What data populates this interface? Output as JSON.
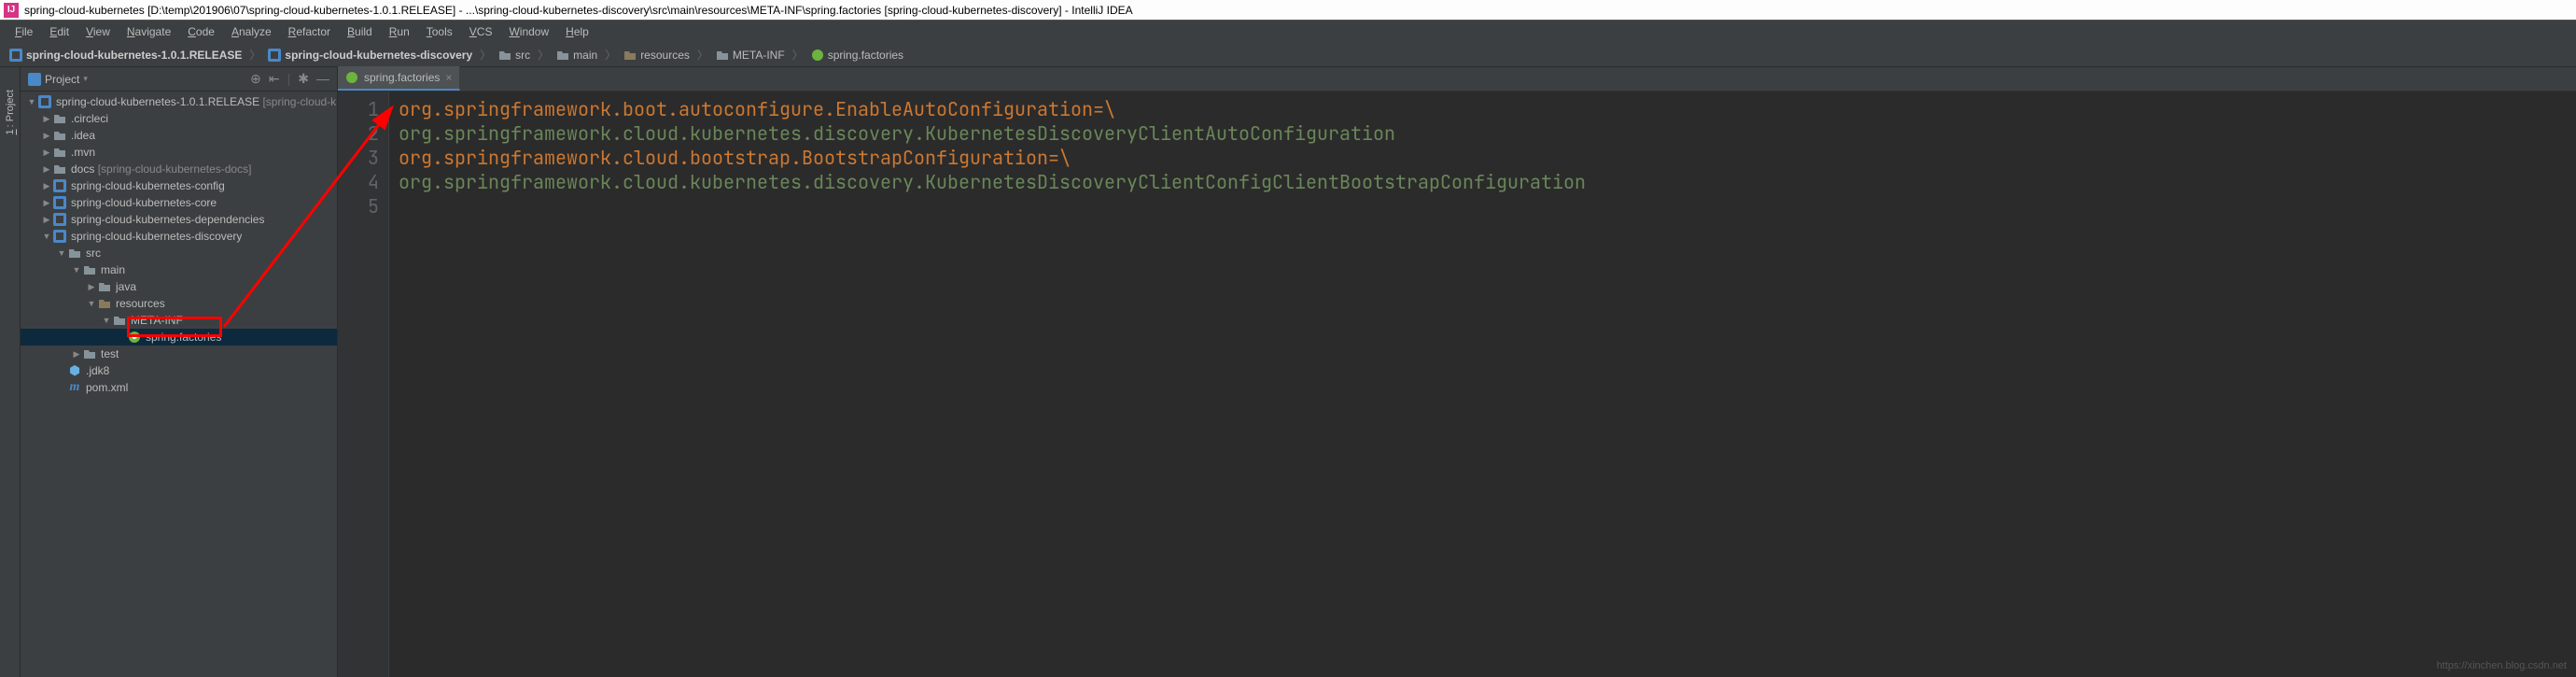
{
  "titlebar": {
    "text": "spring-cloud-kubernetes [D:\\temp\\201906\\07\\spring-cloud-kubernetes-1.0.1.RELEASE] - ...\\spring-cloud-kubernetes-discovery\\src\\main\\resources\\META-INF\\spring.factories [spring-cloud-kubernetes-discovery] - IntelliJ IDEA"
  },
  "menubar": {
    "items": [
      "File",
      "Edit",
      "View",
      "Navigate",
      "Code",
      "Analyze",
      "Refactor",
      "Build",
      "Run",
      "Tools",
      "VCS",
      "Window",
      "Help"
    ]
  },
  "breadcrumb": {
    "items": [
      {
        "label": "spring-cloud-kubernetes-1.0.1.RELEASE",
        "icon": "module",
        "bold": true
      },
      {
        "label": "spring-cloud-kubernetes-discovery",
        "icon": "module",
        "bold": true
      },
      {
        "label": "src",
        "icon": "folder"
      },
      {
        "label": "main",
        "icon": "folder"
      },
      {
        "label": "resources",
        "icon": "resources"
      },
      {
        "label": "META-INF",
        "icon": "folder"
      },
      {
        "label": "spring.factories",
        "icon": "spring"
      }
    ]
  },
  "project_panel": {
    "title": "Project",
    "gutter_label": "1: Project"
  },
  "tree": [
    {
      "depth": 0,
      "arrow": "down",
      "icon": "module",
      "label": "spring-cloud-kubernetes-1.0.1.RELEASE",
      "suffix": " [spring-cloud-k"
    },
    {
      "depth": 1,
      "arrow": "right",
      "icon": "folder",
      "label": ".circleci"
    },
    {
      "depth": 1,
      "arrow": "right",
      "icon": "folder",
      "label": ".idea"
    },
    {
      "depth": 1,
      "arrow": "right",
      "icon": "folder",
      "label": ".mvn"
    },
    {
      "depth": 1,
      "arrow": "right",
      "icon": "folder",
      "label": "docs",
      "suffix": " [spring-cloud-kubernetes-docs]"
    },
    {
      "depth": 1,
      "arrow": "right",
      "icon": "module",
      "label": "spring-cloud-kubernetes-config"
    },
    {
      "depth": 1,
      "arrow": "right",
      "icon": "module",
      "label": "spring-cloud-kubernetes-core"
    },
    {
      "depth": 1,
      "arrow": "right",
      "icon": "module",
      "label": "spring-cloud-kubernetes-dependencies"
    },
    {
      "depth": 1,
      "arrow": "down",
      "icon": "module",
      "label": "spring-cloud-kubernetes-discovery"
    },
    {
      "depth": 2,
      "arrow": "down",
      "icon": "folder",
      "label": "src"
    },
    {
      "depth": 3,
      "arrow": "down",
      "icon": "folder",
      "label": "main"
    },
    {
      "depth": 4,
      "arrow": "right",
      "icon": "folder",
      "label": "java"
    },
    {
      "depth": 4,
      "arrow": "down",
      "icon": "resources",
      "label": "resources"
    },
    {
      "depth": 5,
      "arrow": "down",
      "icon": "folder",
      "label": "META-INF"
    },
    {
      "depth": 6,
      "arrow": "",
      "icon": "spring",
      "label": "spring.factories",
      "selected": true
    },
    {
      "depth": 3,
      "arrow": "right",
      "icon": "folder",
      "label": "test"
    },
    {
      "depth": 2,
      "arrow": "",
      "icon": "jdk",
      "label": ".jdk8"
    },
    {
      "depth": 2,
      "arrow": "",
      "icon": "maven",
      "label": "pom.xml"
    }
  ],
  "editor": {
    "tab": {
      "label": "spring.factories"
    },
    "lines": [
      {
        "num": "1",
        "key": "org.springframework.boot.autoconfigure.EnableAutoConfiguration",
        "sep": "=\\"
      },
      {
        "num": "2",
        "val": "org.springframework.cloud.kubernetes.discovery.KubernetesDiscoveryClientAutoConfiguration"
      },
      {
        "num": "3",
        "key": "org.springframework.cloud.bootstrap.BootstrapConfiguration",
        "sep": "=\\"
      },
      {
        "num": "4",
        "val": "org.springframework.cloud.kubernetes.discovery.KubernetesDiscoveryClientConfigClientBootstrapConfiguration"
      },
      {
        "num": "5",
        "blank": true
      }
    ]
  },
  "watermark": "https://xinchen.blog.csdn.net"
}
